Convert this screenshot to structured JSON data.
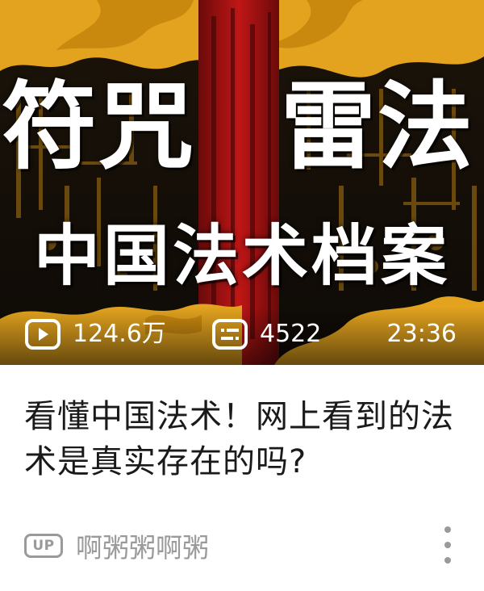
{
  "thumbnail": {
    "headline_left": "符咒",
    "headline_right": "雷法",
    "subheadline": "中国法术档案"
  },
  "stats": {
    "views": "124.6万",
    "views_icon": "play-icon",
    "danmaku": "4522",
    "danmaku_icon": "danmaku-icon",
    "duration": "23:36"
  },
  "video": {
    "title": "看懂中国法术！网上看到的法术是真实存在的吗?"
  },
  "uploader": {
    "badge": "UP",
    "name": "啊粥粥啊粥"
  },
  "more_icon": "more-vertical-icon",
  "colors": {
    "accent_gold": "#e3a31e",
    "seal_red": "#b81414",
    "meta_gray": "#9a9a9a"
  }
}
